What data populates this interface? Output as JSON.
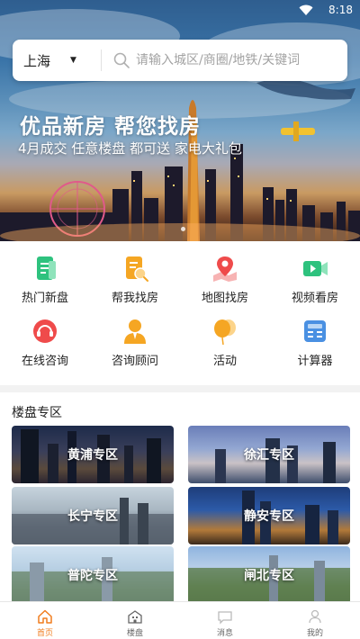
{
  "status_bar": {
    "time": "8:18"
  },
  "search": {
    "city": "上海",
    "placeholder": "请输入城区/商圈/地铁/关键词"
  },
  "banner": {
    "title": "优品新房 帮您找房",
    "subtitle": "4月成交 任意楼盘 都可送 家电大礼包"
  },
  "shortcuts": [
    {
      "label": "热门新盘",
      "icon": "document-icon",
      "color": "#2ec27e"
    },
    {
      "label": "帮我找房",
      "icon": "document-search-icon",
      "color": "#f5a623"
    },
    {
      "label": "地图找房",
      "icon": "map-pin-icon",
      "color": "#ef4b4b"
    },
    {
      "label": "视频看房",
      "icon": "video-camera-icon",
      "color": "#2ec27e"
    },
    {
      "label": "在线咨询",
      "icon": "headset-icon",
      "color": "#ef4b4b"
    },
    {
      "label": "咨询顾问",
      "icon": "consultant-icon",
      "color": "#f5a623"
    },
    {
      "label": "活动",
      "icon": "balloon-icon",
      "color": "#f5a623"
    },
    {
      "label": "计算器",
      "icon": "calculator-icon",
      "color": "#4a90e2"
    }
  ],
  "section": {
    "title": "楼盘专区"
  },
  "districts": [
    {
      "label": "黄浦专区"
    },
    {
      "label": "徐汇专区"
    },
    {
      "label": "长宁专区"
    },
    {
      "label": "静安专区"
    },
    {
      "label": "普陀专区"
    },
    {
      "label": "闸北专区"
    }
  ],
  "bottom_nav": [
    {
      "label": "首页",
      "icon": "home-icon",
      "active": true
    },
    {
      "label": "楼盘",
      "icon": "building-icon",
      "active": false
    },
    {
      "label": "消息",
      "icon": "message-icon",
      "active": false
    },
    {
      "label": "我的",
      "icon": "user-icon",
      "active": false
    }
  ],
  "colors": {
    "accent": "#f07d1e",
    "search_bg": "#ffffff"
  }
}
